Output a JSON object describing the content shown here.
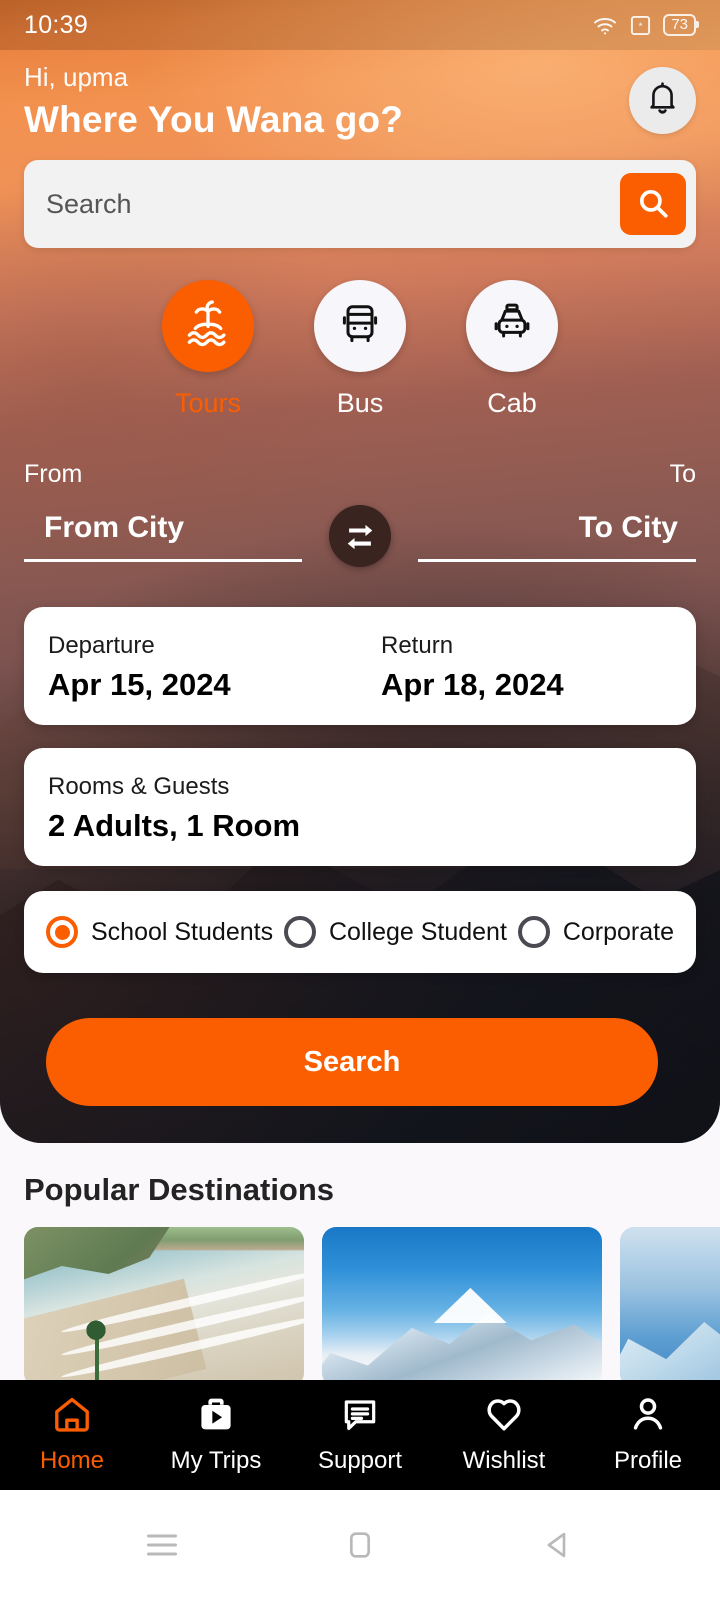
{
  "statusbar": {
    "time": "10:39",
    "wifi_icon": "wifi-icon",
    "sim_icon": "sim-card-icon",
    "battery_level": "73"
  },
  "header": {
    "greeting": "Hi, upma",
    "headline": "Where You Wana go?",
    "bell_icon": "bell-icon"
  },
  "search": {
    "placeholder": "Search",
    "value": "",
    "button_icon": "search-icon"
  },
  "categories": [
    {
      "label": "Tours",
      "icon": "island-palm-icon",
      "active": true
    },
    {
      "label": "Bus",
      "icon": "bus-icon",
      "active": false
    },
    {
      "label": "Cab",
      "icon": "taxi-icon",
      "active": false
    }
  ],
  "route": {
    "from_label": "From",
    "to_label": "To",
    "from_placeholder": "From City",
    "from_value": "",
    "to_placeholder": "To City",
    "to_value": "",
    "swap_icon": "swap-horizontal-icon"
  },
  "dates": {
    "departure_label": "Departure",
    "departure_value": "Apr 15, 2024",
    "return_label": "Return",
    "return_value": "Apr 18, 2024"
  },
  "rooms": {
    "label": "Rooms & Guests",
    "value": "2 Adults, 1 Room"
  },
  "traveller_types": [
    {
      "label": "School Students",
      "selected": true
    },
    {
      "label": "College Student",
      "selected": false
    },
    {
      "label": "Corporate",
      "selected": false
    }
  ],
  "cta": {
    "label": "Search"
  },
  "popular": {
    "title": "Popular Destinations",
    "cards": [
      {
        "image": "beach-coastline-photo"
      },
      {
        "image": "snow-mountain-photo"
      },
      {
        "image": "ice-glacier-photo"
      }
    ]
  },
  "bottom_nav": [
    {
      "label": "Home",
      "icon": "home-icon",
      "active": true
    },
    {
      "label": "My Trips",
      "icon": "briefcase-play-icon",
      "active": false
    },
    {
      "label": "Support",
      "icon": "chat-lines-icon",
      "active": false
    },
    {
      "label": "Wishlist",
      "icon": "heart-icon",
      "active": false
    },
    {
      "label": "Profile",
      "icon": "person-icon",
      "active": false
    }
  ],
  "android_nav": [
    {
      "icon": "recents-menu-icon"
    },
    {
      "icon": "home-square-icon"
    },
    {
      "icon": "back-triangle-icon"
    }
  ],
  "colors": {
    "accent_orange": "#fb5e00",
    "nav_bar_black": "#000000",
    "swap_dark": "#3a2420",
    "page_bg": "#fbf8fb",
    "card_white": "#ffffff"
  }
}
